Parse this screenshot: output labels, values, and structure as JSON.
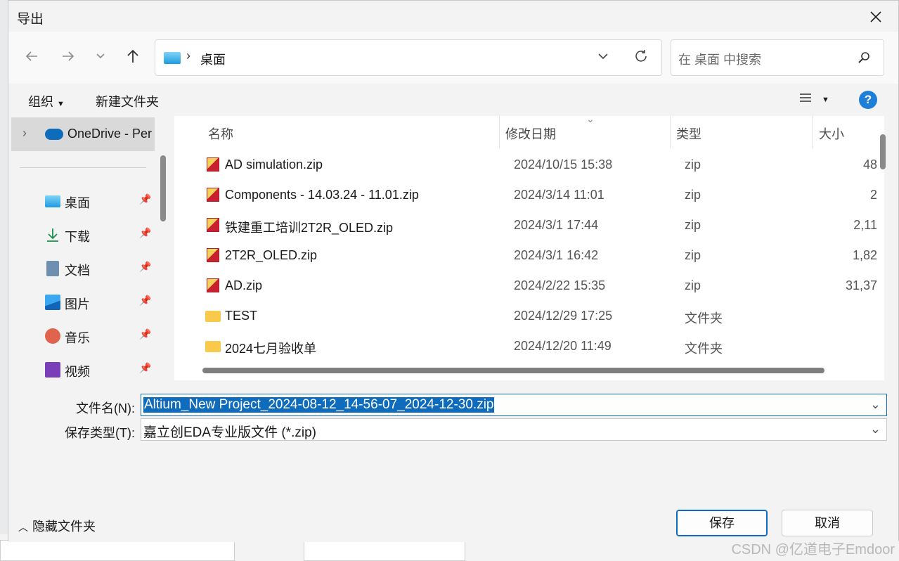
{
  "window": {
    "title": "导出"
  },
  "nav": {
    "breadcrumb": "桌面",
    "search_placeholder": "在 桌面 中搜索"
  },
  "toolbar": {
    "organize": "组织",
    "new_folder": "新建文件夹"
  },
  "sidebar": {
    "onedrive": "OneDrive - Per",
    "items": [
      {
        "label": "桌面",
        "icon": "desktop-icon"
      },
      {
        "label": "下载",
        "icon": "download-icon"
      },
      {
        "label": "文档",
        "icon": "document-icon"
      },
      {
        "label": "图片",
        "icon": "picture-icon"
      },
      {
        "label": "音乐",
        "icon": "music-icon"
      },
      {
        "label": "视频",
        "icon": "video-icon"
      }
    ]
  },
  "columns": {
    "name": "名称",
    "modified": "修改日期",
    "type": "类型",
    "size": "大小"
  },
  "files": [
    {
      "name": "AD simulation.zip",
      "modified": "2024/10/15 15:38",
      "type": "zip",
      "size": "48",
      "kind": "zip"
    },
    {
      "name": "Components - 14.03.24 - 11.01.zip",
      "modified": "2024/3/14 11:01",
      "type": "zip",
      "size": "2",
      "kind": "zip"
    },
    {
      "name": "铁建重工培训2T2R_OLED.zip",
      "modified": "2024/3/1 17:44",
      "type": "zip",
      "size": "2,11",
      "kind": "zip"
    },
    {
      "name": "2T2R_OLED.zip",
      "modified": "2024/3/1 16:42",
      "type": "zip",
      "size": "1,82",
      "kind": "zip"
    },
    {
      "name": "AD.zip",
      "modified": "2024/2/22 15:35",
      "type": "zip",
      "size": "31,37",
      "kind": "zip"
    },
    {
      "name": "TEST",
      "modified": "2024/12/29 17:25",
      "type": "文件夹",
      "size": "",
      "kind": "folder"
    },
    {
      "name": "2024七月验收单",
      "modified": "2024/12/20 11:49",
      "type": "文件夹",
      "size": "",
      "kind": "folder"
    }
  ],
  "form": {
    "filename_label": "文件名(N):",
    "filename_value": "Altium_New Project_2024-08-12_14-56-07_2024-12-30.zip",
    "filetype_label": "保存类型(T):",
    "filetype_value": "嘉立创EDA专业版文件 (*.zip)"
  },
  "footer": {
    "hide_folders": "隐藏文件夹",
    "save": "保存",
    "cancel": "取消"
  },
  "watermark": "CSDN @亿道电子Emdoor",
  "colors": {
    "accent": "#0f6cbd",
    "help": "#1e7fd6"
  }
}
